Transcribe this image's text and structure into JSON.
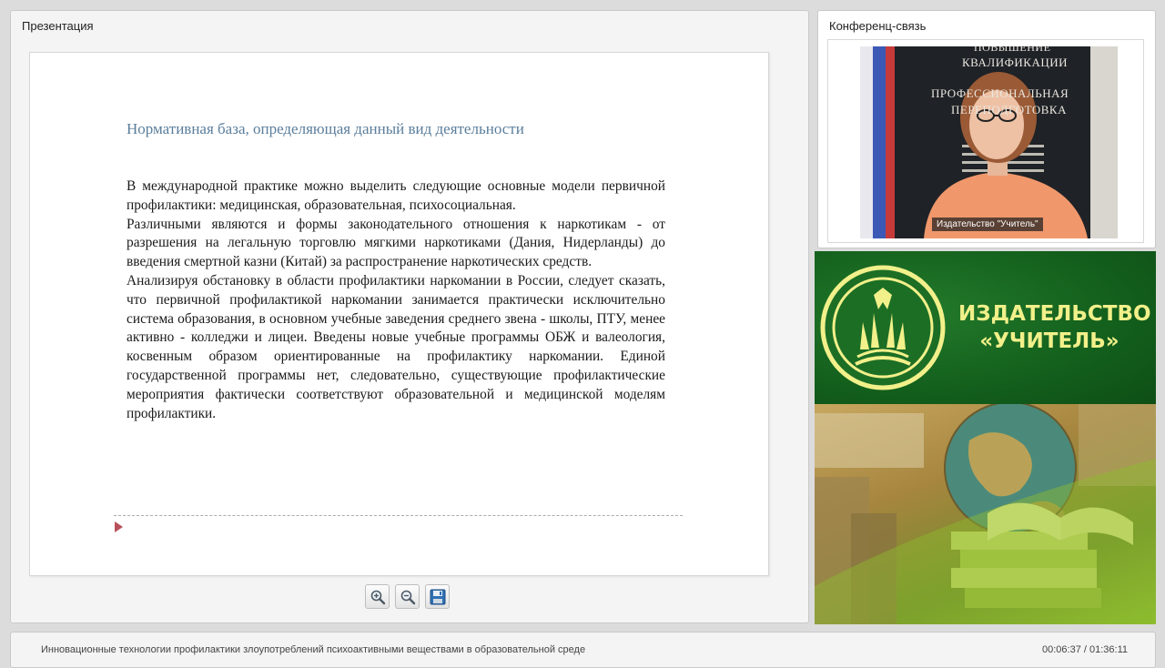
{
  "presentation": {
    "title": "Презентация",
    "slide": {
      "heading": "Нормативная база, определяющая данный вид деятельности",
      "paragraphs": [
        "В международной практике можно выделить следующие основные модели первичной профилактики: медицинская, образовательная, психосоциальная.",
        "Различными являются и формы законодательного отношения к наркотикам - от разрешения на легальную торговлю мягкими наркотиками (Дания, Нидерланды) до введения смертной казни (Китай) за распространение наркотических средств.",
        "Анализируя обстановку в области профилактики наркомании в России, следует сказать, что первичной профилактикой наркомании занимается практически исключительно система образования, в основном учебные заведения среднего звена - школы, ПТУ, менее активно - колледжи и лицеи. Введены новые учебные программы ОБЖ и валеология, косвенным образом ориентированные на профилактику наркомании. Единой государственной программы нет, следовательно, существующие профилактические мероприятия фактически соответствуют образовательной и медицинской моделям профилактики."
      ]
    },
    "toolbar": {
      "zoom_in_icon": "zoom-in-icon",
      "zoom_out_icon": "zoom-out-icon",
      "save_icon": "floppy-disk-icon"
    }
  },
  "conference": {
    "title": "Конференц-связь",
    "banner_lines": [
      "ПОВЫШЕНИЕ",
      "КВАЛИФИКАЦИИ",
      "ПРОФЕССИОНАЛЬНАЯ",
      "ПЕРЕПОДГОТОВКА"
    ],
    "speaker_label": "Издательство \"Учитель\""
  },
  "promo": {
    "publisher_line1": "ИЗДАТЕЛЬСТВО",
    "publisher_line2": "«УЧИТЕЛЬ»",
    "colors": {
      "green": "#135f1c",
      "yellow_text": "#f2f08a"
    }
  },
  "status_bar": {
    "course_title": "Инновационные технологии профилактики злоупотреблений психоактивными веществами в образовательной среде",
    "time": "00:06:37 / 01:36:11"
  }
}
